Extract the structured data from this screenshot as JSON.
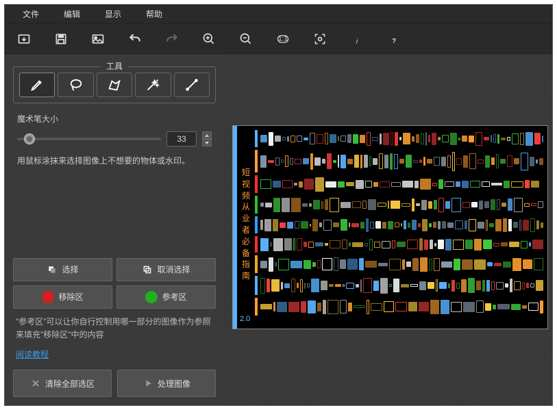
{
  "menu": {
    "file": "文件",
    "edit": "编辑",
    "view": "显示",
    "help": "帮助"
  },
  "toolbar_names": [
    "open",
    "save",
    "image",
    "undo",
    "redo",
    "zoom-in",
    "zoom-out",
    "zoom-1-1",
    "fit",
    "info",
    "help"
  ],
  "tools": {
    "title": "工具",
    "items": [
      "marker",
      "lasso",
      "polygon",
      "magic",
      "line"
    ],
    "brush_label": "魔术笔大小",
    "brush_value": "33",
    "hint": "用鼠标涂抹来选择图像上不想要的物体或水印。"
  },
  "buttons": {
    "select": "选择",
    "deselect": "取消选择",
    "remove_zone": "移除区",
    "ref_zone": "参考区"
  },
  "note": "\"参考区\"可以让你自行控制用哪一部分的图像作为参照来填充\"移除区\"中的内容",
  "tutorial_link": "阅读教程",
  "bottom": {
    "clear": "清除全部选区",
    "process": "处理图像"
  },
  "canvas": {
    "sidebar_text": "短视频从业者必备指南",
    "version": "2.0",
    "row_colors": [
      "#5ab1ff",
      "#ffa030",
      "#ff3030",
      "#30c030",
      "#30a0ff",
      "#ff3030",
      "#ffa030"
    ]
  }
}
